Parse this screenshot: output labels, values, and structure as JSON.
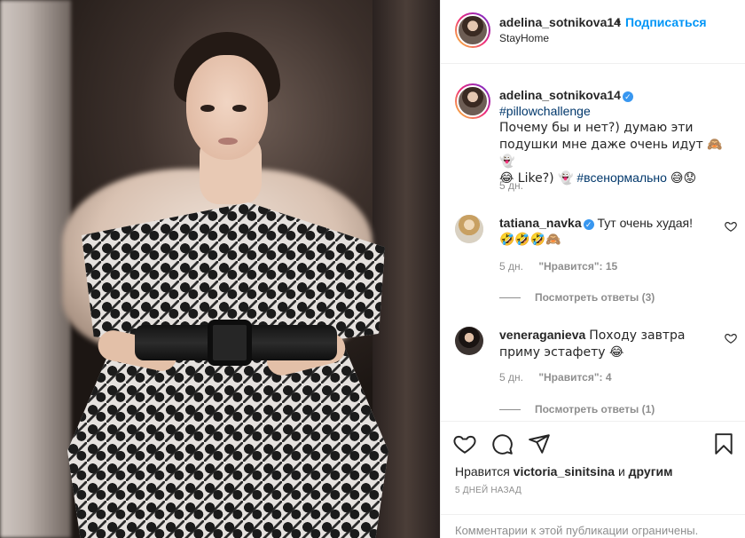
{
  "post_header": {
    "username": "adelina_sotnikova14",
    "dot": "•",
    "follow_label": "Подписаться",
    "location": "StayHome"
  },
  "caption": {
    "username": "adelina_sotnikova14",
    "hashtag": "#pillowchallenge",
    "text_1": "Почему бы и нет?) думаю эти подушки мне даже очень идут 🙈👻",
    "text_2": "😂 Like?) 👻",
    "hashtag_2": "#всенормально",
    "text_3": "😅😟",
    "time": "5 дн."
  },
  "comments": [
    {
      "username": "tatiana_navka",
      "text": "Тут очень худая!",
      "emoji": "🤣🤣🤣🙈",
      "time": "5 дн.",
      "likes_label": "\"Нравится\": 15",
      "replies_label": "Посмотреть ответы (3)"
    },
    {
      "username": "veneraganieva",
      "text": "Походу завтра приму эстафету 😂",
      "time": "5 дн.",
      "likes_label": "\"Нравится\": 4",
      "replies_label": "Посмотреть ответы (1)"
    }
  ],
  "actions": {
    "likes_prefix": "Нравится",
    "likes_user": "victoria_sinitsina",
    "likes_middle": "и",
    "likes_suffix": "другим",
    "date": "5 ДНЕЙ НАЗАД",
    "comments_restricted": "Комментарии к этой публикации ограничены."
  },
  "icons": {
    "verified": "verified-badge-icon",
    "like": "heart-icon",
    "comment": "comment-icon",
    "share": "share-icon",
    "save": "bookmark-icon"
  },
  "colors": {
    "accent": "#0095f6",
    "hashtag": "#00376b",
    "muted": "#8e8e8e",
    "verified": "#3897f0"
  }
}
